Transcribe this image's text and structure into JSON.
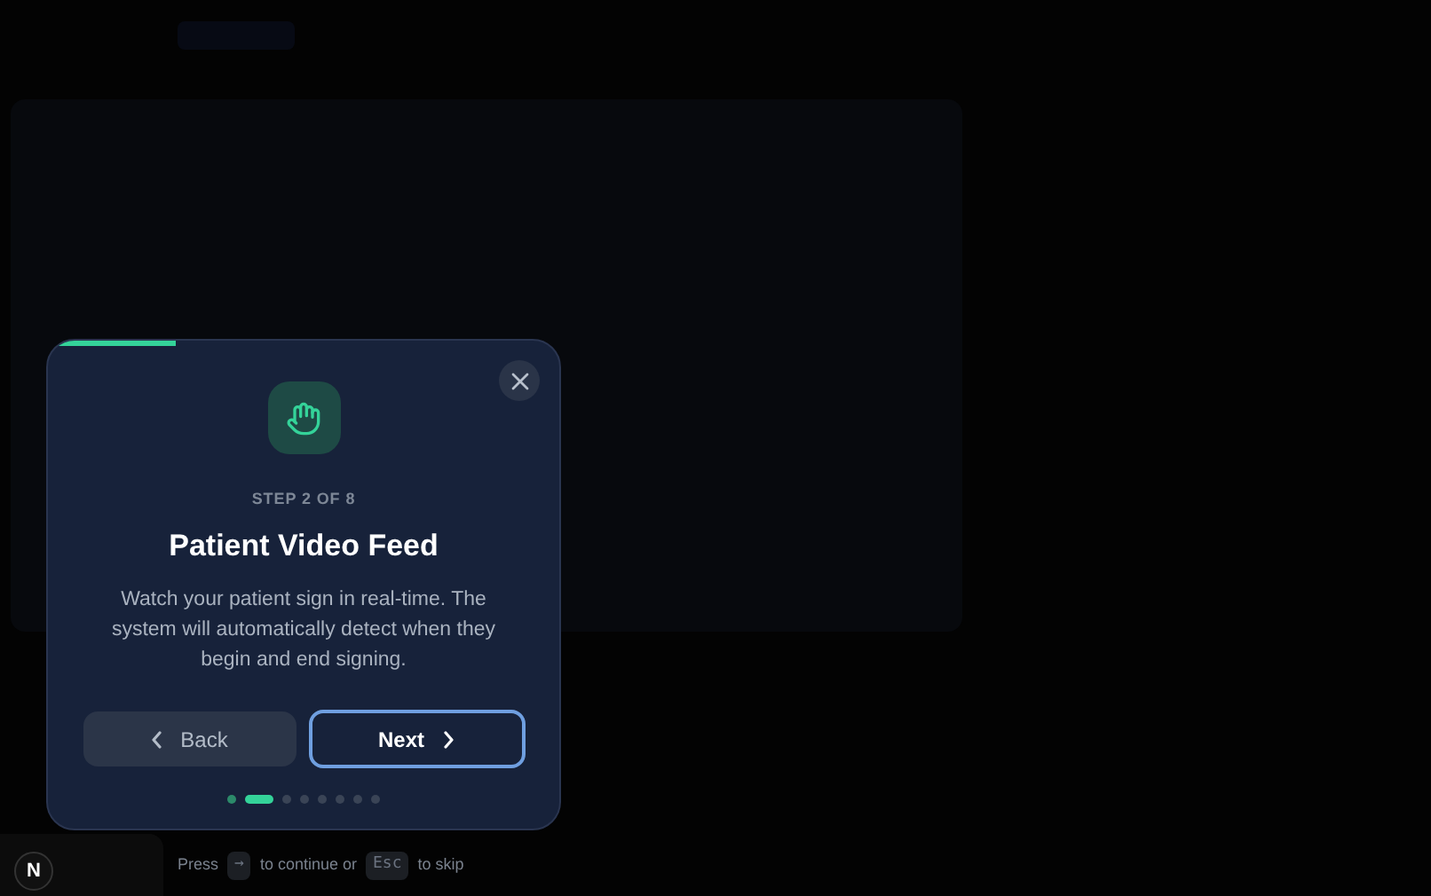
{
  "tour": {
    "progress": {
      "level": 0.25
    },
    "step_label": "STEP 2 OF 8",
    "title": "Patient Video Feed",
    "description": "Watch your patient sign in real-time. The system will automatically detect when they begin and end signing.",
    "buttons": [
      {
        "kind": "back",
        "label": "Back"
      },
      {
        "kind": "next",
        "label": "Next"
      }
    ],
    "dots": [
      {
        "completed": true,
        "selected": false
      },
      {
        "completed": false,
        "selected": true
      },
      {
        "completed": false,
        "selected": false
      },
      {
        "completed": false,
        "selected": false
      },
      {
        "completed": false,
        "selected": false
      },
      {
        "completed": false,
        "selected": false
      },
      {
        "completed": false,
        "selected": false
      },
      {
        "completed": false,
        "selected": false
      }
    ]
  },
  "hint": [
    {
      "kind": "text",
      "text": "Press"
    },
    {
      "kind": "key",
      "text": "→"
    },
    {
      "kind": "text",
      "text": "to continue or"
    },
    {
      "kind": "key",
      "text": "Esc"
    },
    {
      "kind": "text",
      "text": "to skip"
    }
  ],
  "badge": {
    "letter": "N"
  }
}
